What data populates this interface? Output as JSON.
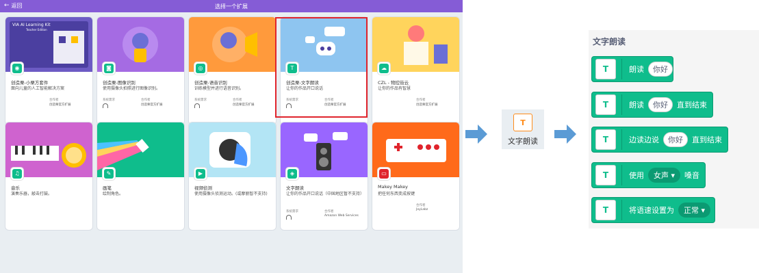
{
  "topbar": {
    "back": "返回",
    "title": "选择一个扩展"
  },
  "cards": [
    {
      "name": "创造栗-小栗方套件",
      "desc": "面向儿童的人工智能解决方案",
      "req_label": "",
      "partner_label": "合作者",
      "partner": "创造栗官方扩展",
      "art_text": "VIA AI Learning Kit",
      "art_sub": "Teacher Edition"
    },
    {
      "name": "创造栗-图像识别",
      "desc": "使用摄像头拍照进行图像识别。",
      "req_label": "系统需求",
      "partner_label": "合作者",
      "partner": "创造栗官方扩展"
    },
    {
      "name": "创造栗-语音识别",
      "desc": "训练模型并进行语音识别。",
      "req_label": "系统需求",
      "partner_label": "合作者",
      "partner": "创造栗官方扩展"
    },
    {
      "name": "创造栗-文字朗读",
      "desc": "让你的作品开口说话",
      "req_label": "系统需求",
      "partner_label": "合作者",
      "partner": "创造栗官方扩展"
    },
    {
      "name": "CZL - 物控街云",
      "desc": "让你的作品有智慧",
      "req_label": "",
      "partner_label": "合作者",
      "partner": "创造栗官方扩展"
    },
    {
      "name": "音乐",
      "desc": "演奏乐器，敲击打鼓。",
      "req_label": "",
      "partner_label": "",
      "partner": ""
    },
    {
      "name": "画笔",
      "desc": "绘制角色。",
      "req_label": "",
      "partner_label": "",
      "partner": ""
    },
    {
      "name": "视频侦测",
      "desc": "使用摄像头侦测运动。(或摩丽智不支持)",
      "req_label": "",
      "partner_label": "",
      "partner": ""
    },
    {
      "name": "文字朗读",
      "desc": "让你的作品开口说话（中国地区暂不支持）",
      "req_label": "系统需求",
      "partner_label": "合作者",
      "partner": "Amazon Web Services"
    },
    {
      "name": "Makey Makey",
      "desc": "把任何东西变成按键",
      "req_label": "",
      "partner_label": "合作者",
      "partner": "JoyLabz"
    }
  ],
  "middle": {
    "label": "文字朗读"
  },
  "right": {
    "title": "文字朗读",
    "blocks": [
      {
        "text": "朗读",
        "pill": "你好",
        "after": "",
        "drop": ""
      },
      {
        "text": "朗读",
        "pill": "你好",
        "after": "直到结束",
        "drop": ""
      },
      {
        "text": "边读边说",
        "pill": "你好",
        "after": "直到结束",
        "drop": ""
      },
      {
        "text": "使用",
        "pill": "",
        "after": "嗓音",
        "drop": "女声 ▾"
      },
      {
        "text": "将语速设置为",
        "pill": "",
        "after": "",
        "drop": "正常 ▾"
      }
    ]
  },
  "colors": {
    "topbar": "#855cd6",
    "extension_green": "#0fbd8c",
    "selection_red": "#e0242c",
    "arrow_blue": "#5b9bd5"
  }
}
